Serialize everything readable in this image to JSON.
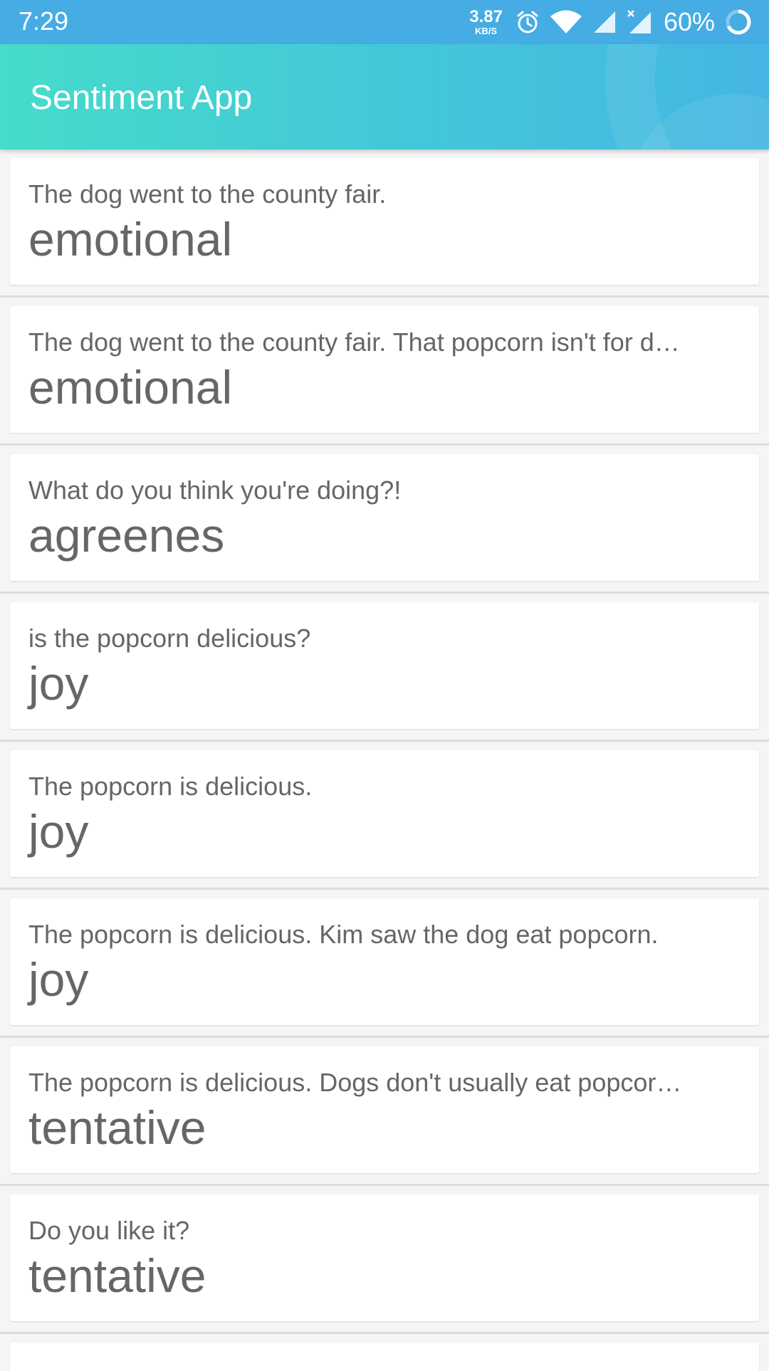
{
  "status_bar": {
    "time": "7:29",
    "speed_value": "3.87",
    "speed_unit": "KB/S",
    "battery": "60%",
    "icons": [
      "alarm-icon",
      "wifi-icon",
      "signal-icon",
      "signal-x-icon",
      "battery-icon"
    ]
  },
  "app_bar": {
    "title": "Sentiment App"
  },
  "items": [
    {
      "sentence": "The dog went to the county fair.",
      "sentiment": "emotional"
    },
    {
      "sentence": "The dog went to the county fair.  That popcorn isn't for d…",
      "sentiment": "emotional"
    },
    {
      "sentence": "What do you think you're doing?!",
      "sentiment": "agreenes"
    },
    {
      "sentence": "is the popcorn delicious?",
      "sentiment": "joy"
    },
    {
      "sentence": "The popcorn is delicious.",
      "sentiment": "joy"
    },
    {
      "sentence": "The popcorn is delicious.  Kim saw the dog eat popcorn.",
      "sentiment": "joy"
    },
    {
      "sentence": "The popcorn is delicious.  Dogs don't usually eat popcor…",
      "sentiment": "tentative"
    },
    {
      "sentence": "Do you like it?",
      "sentiment": "tentative"
    }
  ],
  "colors": {
    "status_bar": "#45ace4",
    "app_bar_start": "#45dccb",
    "app_bar_end": "#45b6e3",
    "text": "#666666",
    "background": "#f5f5f5"
  }
}
